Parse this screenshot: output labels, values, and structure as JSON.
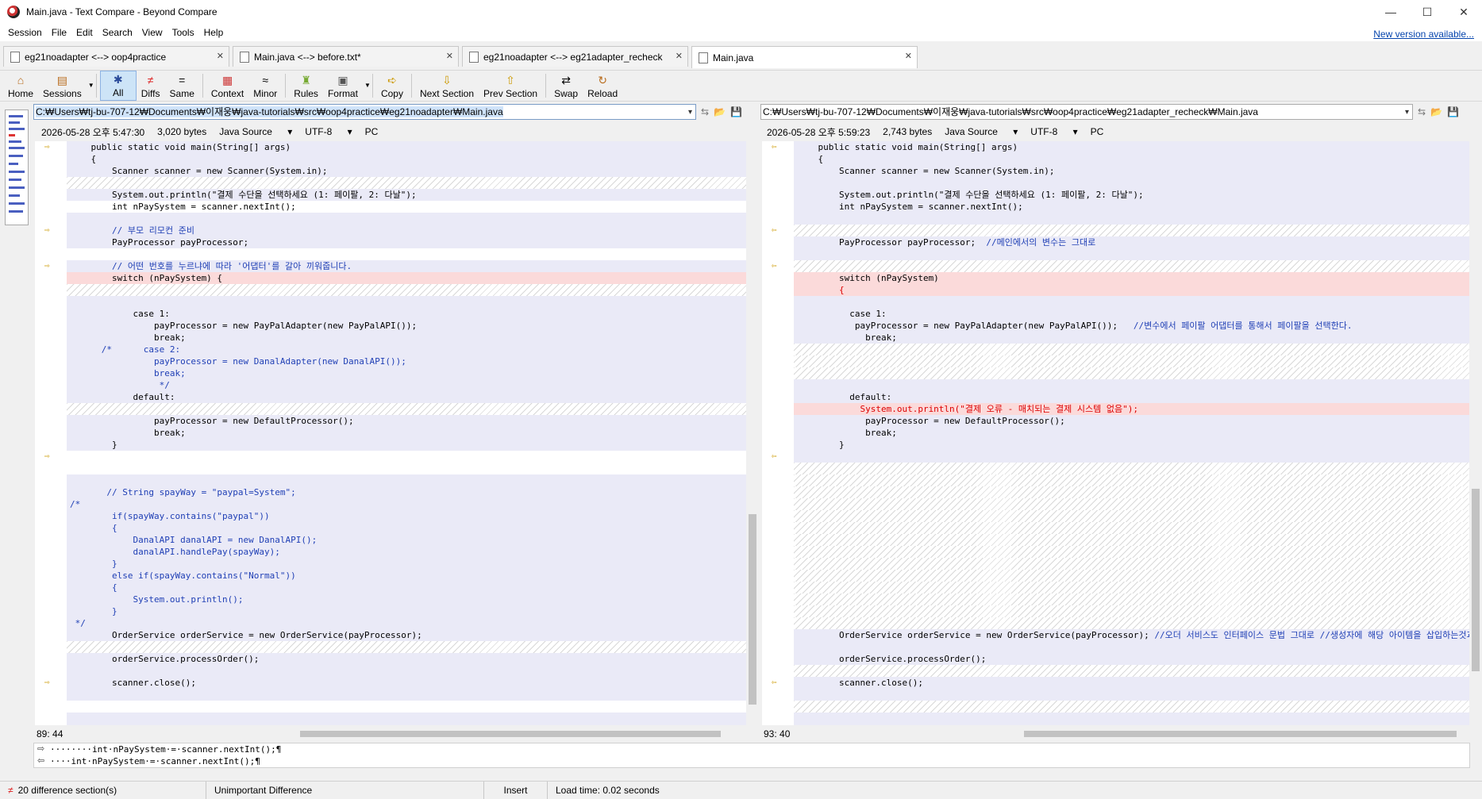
{
  "window": {
    "title": "Main.java - Text Compare - Beyond Compare",
    "controls": [
      "—",
      "☐",
      "✕"
    ]
  },
  "menu": [
    "Session",
    "File",
    "Edit",
    "Search",
    "View",
    "Tools",
    "Help"
  ],
  "new_version": "New version available...",
  "tabs": [
    {
      "label": "eg21noadapter <--> oop4practice",
      "close": "✕"
    },
    {
      "label": "Main.java <--> before.txt*",
      "close": "✕"
    },
    {
      "label": "eg21noadapter <--> eg21adapter_recheck",
      "close": "✕"
    },
    {
      "label": "Main.java",
      "close": "✕"
    }
  ],
  "toolbar": [
    {
      "label": "Home",
      "icon": "home-icon",
      "glyph": "⌂"
    },
    {
      "label": "Sessions",
      "icon": "sessions-icon",
      "glyph": "▤"
    },
    {
      "label": "All",
      "icon": "all-icon",
      "glyph": "✱"
    },
    {
      "label": "Diffs",
      "icon": "diffs-icon",
      "glyph": "≠"
    },
    {
      "label": "Same",
      "icon": "same-icon",
      "glyph": "="
    },
    {
      "label": "Context",
      "icon": "context-icon",
      "glyph": "▦"
    },
    {
      "label": "Minor",
      "icon": "minor-icon",
      "glyph": "≈"
    },
    {
      "label": "Rules",
      "icon": "rules-icon",
      "glyph": "♜"
    },
    {
      "label": "Format",
      "icon": "format-icon",
      "glyph": "▣"
    },
    {
      "label": "Copy",
      "icon": "copy-icon",
      "glyph": "➪"
    },
    {
      "label": "Next Section",
      "icon": "next-section-icon",
      "glyph": "⇩"
    },
    {
      "label": "Prev Section",
      "icon": "prev-section-icon",
      "glyph": "⇧"
    },
    {
      "label": "Swap",
      "icon": "swap-icon",
      "glyph": "⇄"
    },
    {
      "label": "Reload",
      "icon": "reload-icon",
      "glyph": "↻"
    }
  ],
  "left": {
    "path": "C:₩Users₩tj-bu-707-12₩Documents₩이재웅₩java-tutorials₩src₩oop4practice₩eg21noadapter₩Main.java",
    "date": "2026-05-28 오후 5:47:30",
    "size": "3,020 bytes",
    "syntax": "Java Source",
    "encoding": "UTF-8",
    "lineend": "PC",
    "position": "89: 44"
  },
  "right": {
    "path": "C:₩Users₩tj-bu-707-12₩Documents₩이재웅₩java-tutorials₩src₩oop4practice₩eg21adapter_recheck₩Main.java",
    "date": "2026-05-28 오후 5:59:23",
    "size": "2,743 bytes",
    "syntax": "Java Source",
    "encoding": "UTF-8",
    "lineend": "PC",
    "position": "93: 40"
  },
  "left_lines": [
    {
      "t": "    public static void main(String[] args)",
      "k": ""
    },
    {
      "t": "    {",
      "k": ""
    },
    {
      "t": "        Scanner scanner = new Scanner(System.in);",
      "k": ""
    },
    {
      "t": "",
      "k": "hatch"
    },
    {
      "t": "        System.out.println(\"결제 수단을 선택하세요 (1: 페이팔, 2: 다날\");",
      "k": ""
    },
    {
      "t": "        int nPaySystem = scanner.nextInt();",
      "k": "white"
    },
    {
      "t": "",
      "k": ""
    },
    {
      "t": "        // 부모 리모컨 준비",
      "k": "",
      "c": "blue"
    },
    {
      "t": "        PayProcessor payProcessor;",
      "k": ""
    },
    {
      "t": "",
      "k": "white"
    },
    {
      "t": "        // 어떤 번호를 누르냐에 따라 '어댑터'를 갈아 끼워줍니다.",
      "k": "",
      "c": "blue"
    },
    {
      "t": "        switch (nPaySystem) {",
      "k": "red"
    },
    {
      "t": "",
      "k": "hatch"
    },
    {
      "t": "",
      "k": ""
    },
    {
      "t": "            case 1:",
      "k": ""
    },
    {
      "t": "                payProcessor = new PayPalAdapter(new PayPalAPI());",
      "k": ""
    },
    {
      "t": "                break;",
      "k": ""
    },
    {
      "t": "      /*      case 2:",
      "k": "",
      "c": "blue"
    },
    {
      "t": "                payProcessor = new DanalAdapter(new DanalAPI());",
      "k": "",
      "c": "blue"
    },
    {
      "t": "                break;",
      "k": "",
      "c": "blue"
    },
    {
      "t": "                 */",
      "k": "",
      "c": "blue"
    },
    {
      "t": "            default:",
      "k": ""
    },
    {
      "t": "",
      "k": "hatch"
    },
    {
      "t": "                payProcessor = new DefaultProcessor();",
      "k": ""
    },
    {
      "t": "                break;",
      "k": ""
    },
    {
      "t": "        }",
      "k": ""
    },
    {
      "t": "",
      "k": "white"
    },
    {
      "t": "",
      "k": "white"
    },
    {
      "t": "",
      "k": ""
    },
    {
      "t": "       // String spayWay = \"paypal=System\";",
      "k": "",
      "c": "blue"
    },
    {
      "t": "/*",
      "k": "",
      "c": "blue"
    },
    {
      "t": "        if(spayWay.contains(\"paypal\"))",
      "k": "",
      "c": "blue"
    },
    {
      "t": "        {",
      "k": "",
      "c": "blue"
    },
    {
      "t": "            DanalAPI danalAPI = new DanalAPI();",
      "k": "",
      "c": "blue"
    },
    {
      "t": "            danalAPI.handlePay(spayWay);",
      "k": "",
      "c": "blue"
    },
    {
      "t": "        }",
      "k": "",
      "c": "blue"
    },
    {
      "t": "        else if(spayWay.contains(\"Normal\"))",
      "k": "",
      "c": "blue"
    },
    {
      "t": "        {",
      "k": "",
      "c": "blue"
    },
    {
      "t": "            System.out.println();",
      "k": "",
      "c": "blue"
    },
    {
      "t": "        }",
      "k": "",
      "c": "blue"
    },
    {
      "t": " */",
      "k": "",
      "c": "blue"
    },
    {
      "t": "        OrderService orderService = new OrderService(payProcessor);",
      "k": ""
    },
    {
      "t": "",
      "k": "hatch"
    },
    {
      "t": "        orderService.processOrder();",
      "k": ""
    },
    {
      "t": "",
      "k": ""
    },
    {
      "t": "        scanner.close();",
      "k": ""
    },
    {
      "t": "",
      "k": ""
    },
    {
      "t": "",
      "k": "white"
    },
    {
      "t": "",
      "k": ""
    },
    {
      "t": "    }",
      "k": ""
    },
    {
      "t": "}",
      "k": ""
    }
  ],
  "right_lines": [
    {
      "t": "    public static void main(String[] args)",
      "k": ""
    },
    {
      "t": "    {",
      "k": ""
    },
    {
      "t": "        Scanner scanner = new Scanner(System.in);",
      "k": ""
    },
    {
      "t": "",
      "k": ""
    },
    {
      "t": "        System.out.println(\"결제 수단을 선택하세요 (1: 페이팔, 2: 다날\");",
      "k": ""
    },
    {
      "t": "        int nPaySystem = scanner.nextInt();",
      "k": ""
    },
    {
      "t": "",
      "k": ""
    },
    {
      "t": "",
      "k": "hatch"
    },
    {
      "t": "        PayProcessor payProcessor;  //메인에서의 변수는 그대로",
      "k": "",
      "c": "blue2"
    },
    {
      "t": "",
      "k": ""
    },
    {
      "t": "",
      "k": "hatch"
    },
    {
      "t": "        switch (nPaySystem)",
      "k": "red"
    },
    {
      "t": "        {",
      "k": "red",
      "c": "red"
    },
    {
      "t": "",
      "k": ""
    },
    {
      "t": "          case 1:",
      "k": ""
    },
    {
      "t": "           payProcessor = new PayPalAdapter(new PayPalAPI());   //변수에서 페이팔 어댑터를 통해서 페이팔을 선택한다.",
      "k": "",
      "c": "blue3"
    },
    {
      "t": "             break;",
      "k": ""
    },
    {
      "t": "",
      "k": "hatch"
    },
    {
      "t": "",
      "k": "hatch"
    },
    {
      "t": "",
      "k": "hatch"
    },
    {
      "t": "",
      "k": ""
    },
    {
      "t": "          default:",
      "k": ""
    },
    {
      "t": "            System.out.println(\"결제 오류 - 매치되는 결제 시스템 없음\");",
      "k": "red",
      "c": "red"
    },
    {
      "t": "             payProcessor = new DefaultProcessor();",
      "k": ""
    },
    {
      "t": "             break;",
      "k": ""
    },
    {
      "t": "        }",
      "k": ""
    },
    {
      "t": "",
      "k": ""
    },
    {
      "t": "",
      "k": "hatch"
    },
    {
      "t": "",
      "k": "hatch"
    },
    {
      "t": "",
      "k": "hatch"
    },
    {
      "t": "",
      "k": "hatch"
    },
    {
      "t": "",
      "k": "hatch"
    },
    {
      "t": "",
      "k": "hatch"
    },
    {
      "t": "",
      "k": "hatch"
    },
    {
      "t": "",
      "k": "hatch"
    },
    {
      "t": "",
      "k": "hatch"
    },
    {
      "t": "",
      "k": "hatch"
    },
    {
      "t": "",
      "k": "hatch"
    },
    {
      "t": "",
      "k": "hatch"
    },
    {
      "t": "",
      "k": "hatch"
    },
    {
      "t": "",
      "k": "hatch"
    },
    {
      "t": "        OrderService orderService = new OrderService(payProcessor); //오더 서비스도 인터페이스 문법 그대로 //생성자에 해당 아이템을 삽입하는것과",
      "k": "",
      "c": "blue4"
    },
    {
      "t": "",
      "k": ""
    },
    {
      "t": "        orderService.processOrder();",
      "k": ""
    },
    {
      "t": "",
      "k": "hatch"
    },
    {
      "t": "        scanner.close();",
      "k": ""
    },
    {
      "t": "",
      "k": ""
    },
    {
      "t": "",
      "k": "hatch"
    },
    {
      "t": "",
      "k": ""
    },
    {
      "t": "    }",
      "k": ""
    },
    {
      "t": "}",
      "k": ""
    }
  ],
  "detail": [
    "········int·nPaySystem·=·scanner.nextInt();¶",
    "····int·nPaySystem·=·scanner.nextInt();¶"
  ],
  "status": {
    "diff_count": "20 difference section(s)",
    "importance": "Unimportant Difference",
    "mode": "Insert",
    "load_time": "Load time: 0.02 seconds"
  },
  "colors": {
    "accent": "#8db2e3",
    "diff_bg": "#fbdada",
    "pane_bg": "#eaeaf7",
    "comment": "#1f3fb5"
  }
}
